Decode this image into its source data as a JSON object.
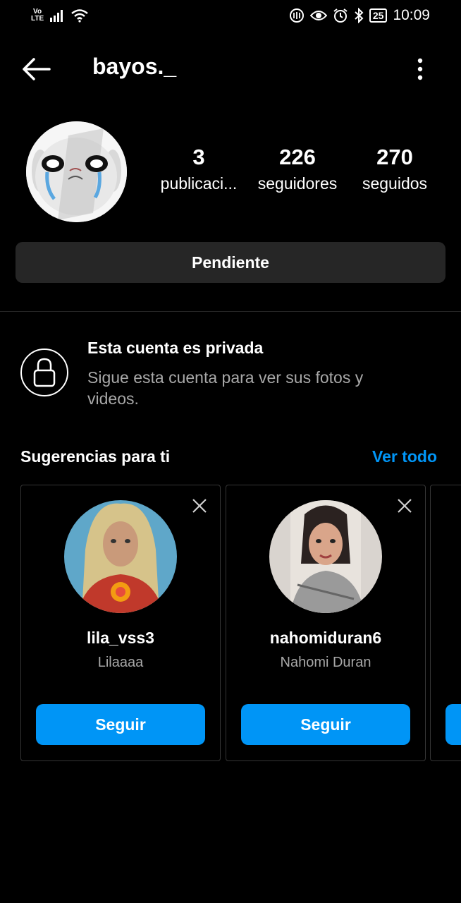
{
  "status_bar": {
    "volte_top": "Vo",
    "volte_bottom": "LTE",
    "battery": "25",
    "time": "10:09",
    "icons": [
      "signal-icon",
      "wifi-icon",
      "nfc-icon",
      "eye-icon",
      "alarm-icon",
      "bluetooth-icon",
      "battery-icon"
    ]
  },
  "header": {
    "username": "bayos._",
    "icons": [
      "back-arrow-icon",
      "more-options-icon"
    ]
  },
  "profile": {
    "stats": [
      {
        "value": "3",
        "label": "publicaci..."
      },
      {
        "value": "226",
        "label": "seguidores"
      },
      {
        "value": "270",
        "label": "seguidos"
      }
    ],
    "pending_label": "Pendiente"
  },
  "private_notice": {
    "title": "Esta cuenta es privada",
    "description": "Sigue esta cuenta para ver sus fotos y videos.",
    "icon": "lock-icon"
  },
  "suggestions": {
    "title": "Sugerencias para ti",
    "see_all": "Ver todo",
    "cards": [
      {
        "username": "lila_vss3",
        "name": "Lilaaaa",
        "button": "Seguir"
      },
      {
        "username": "nahomiduran6",
        "name": "Nahomi Duran",
        "button": "Seguir"
      }
    ]
  },
  "colors": {
    "background": "#000000",
    "accent": "#0095f6",
    "button_dark": "#262626",
    "secondary_text": "#a8a8a8"
  }
}
